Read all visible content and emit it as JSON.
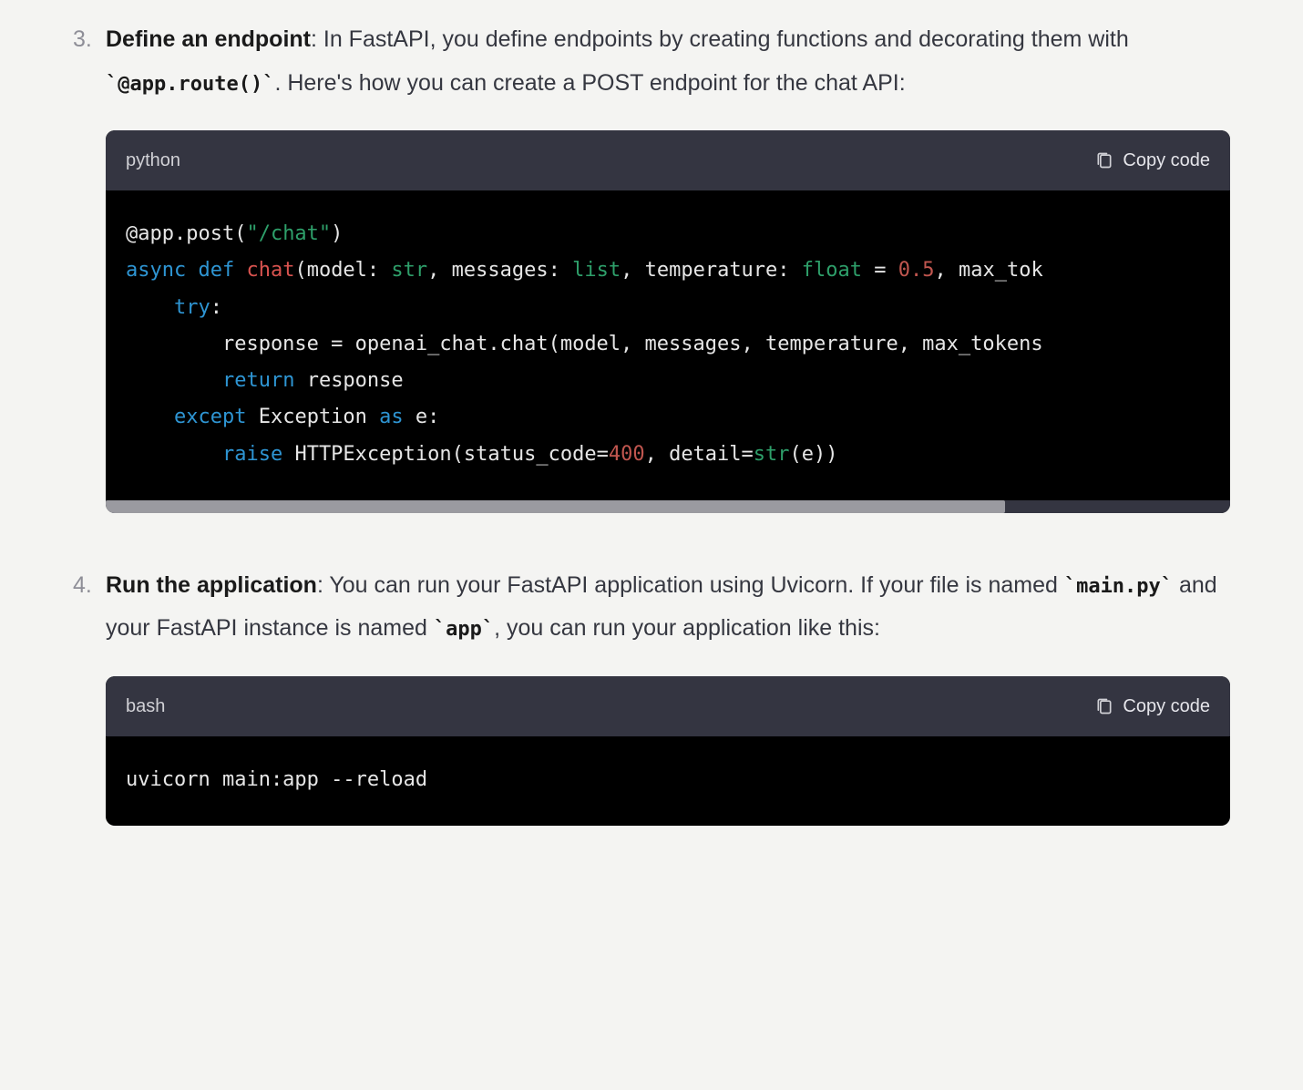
{
  "steps": [
    {
      "title": "Define an endpoint",
      "text_before_code": ": In FastAPI, you define endpoints by creating functions and decorating them with ",
      "inline_code": "`@app.route()`",
      "text_after_code": ". Here's how you can create a POST endpoint for the chat API:"
    },
    {
      "title": "Run the application",
      "text_before_code": ": You can run your FastAPI application using Uvicorn. If your file is named ",
      "inline_code": "`main.py`",
      "text_mid": " and your FastAPI instance is named ",
      "inline_code2": "`app`",
      "text_after_code": ", you can run your application like this:"
    }
  ],
  "codeblocks": [
    {
      "lang": "python",
      "copy_label": "Copy code",
      "scrollable": true,
      "tokens": [
        [
          {
            "t": "@app.post(",
            "c": "tok-deco"
          },
          {
            "t": "\"/chat\"",
            "c": "tok-str"
          },
          {
            "t": ")",
            "c": "tok-deco"
          }
        ],
        [
          {
            "t": "async ",
            "c": "tok-kw"
          },
          {
            "t": "def ",
            "c": "tok-def"
          },
          {
            "t": "chat",
            "c": "tok-fn"
          },
          {
            "t": "(model: ",
            "c": "tok-punct"
          },
          {
            "t": "str",
            "c": "tok-type"
          },
          {
            "t": ", messages: ",
            "c": "tok-punct"
          },
          {
            "t": "list",
            "c": "tok-type"
          },
          {
            "t": ", temperature: ",
            "c": "tok-punct"
          },
          {
            "t": "float",
            "c": "tok-type"
          },
          {
            "t": " = ",
            "c": "tok-punct"
          },
          {
            "t": "0.5",
            "c": "tok-num"
          },
          {
            "t": ", max_tok",
            "c": "tok-punct"
          }
        ],
        [
          {
            "t": "    ",
            "c": "tok-punct"
          },
          {
            "t": "try",
            "c": "tok-kw"
          },
          {
            "t": ":",
            "c": "tok-punct"
          }
        ],
        [
          {
            "t": "        response = openai_chat.chat(model, messages, temperature, max_tokens",
            "c": "tok-id"
          }
        ],
        [
          {
            "t": "        ",
            "c": "tok-punct"
          },
          {
            "t": "return",
            "c": "tok-kw"
          },
          {
            "t": " response",
            "c": "tok-id"
          }
        ],
        [
          {
            "t": "    ",
            "c": "tok-punct"
          },
          {
            "t": "except",
            "c": "tok-kw"
          },
          {
            "t": " Exception ",
            "c": "tok-id"
          },
          {
            "t": "as",
            "c": "tok-kw"
          },
          {
            "t": " e:",
            "c": "tok-id"
          }
        ],
        [
          {
            "t": "        ",
            "c": "tok-punct"
          },
          {
            "t": "raise",
            "c": "tok-kw"
          },
          {
            "t": " HTTPException(status_code=",
            "c": "tok-id"
          },
          {
            "t": "400",
            "c": "tok-num"
          },
          {
            "t": ", detail=",
            "c": "tok-id"
          },
          {
            "t": "str",
            "c": "tok-builtin"
          },
          {
            "t": "(e))",
            "c": "tok-id"
          }
        ]
      ]
    },
    {
      "lang": "bash",
      "copy_label": "Copy code",
      "scrollable": false,
      "tokens": [
        [
          {
            "t": "uvicorn main:app --reload",
            "c": "tok-id"
          }
        ]
      ]
    }
  ]
}
